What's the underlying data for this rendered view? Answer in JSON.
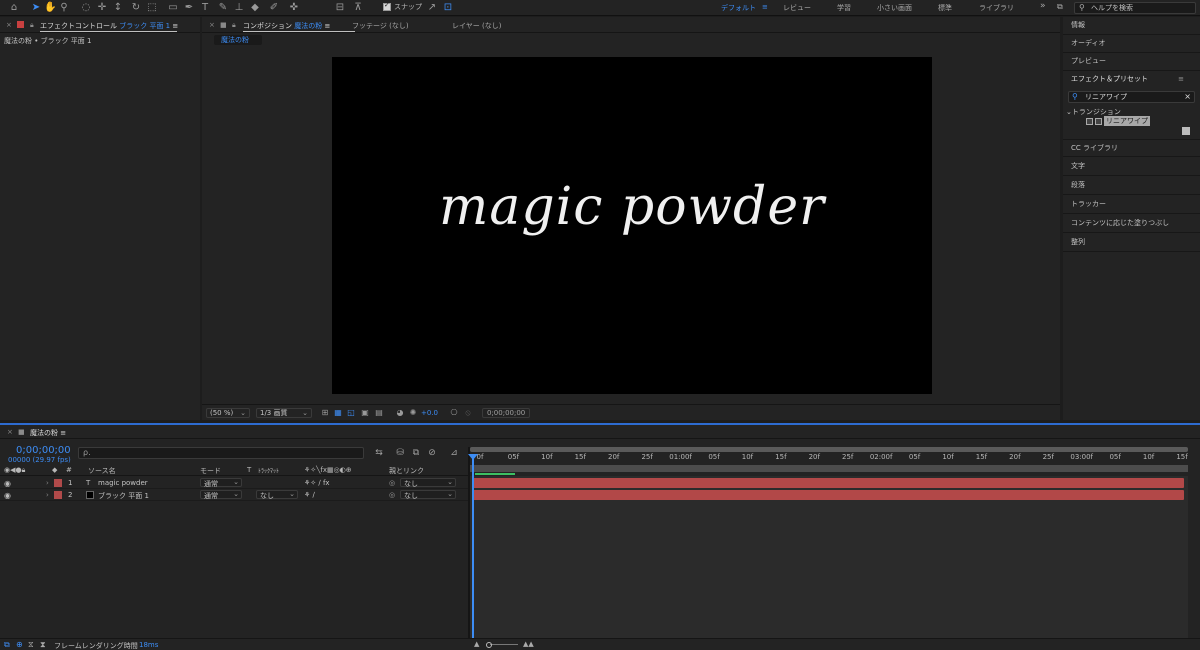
{
  "workspaces": [
    {
      "label": "デフォルト",
      "active": true
    },
    {
      "label": "レビュー"
    },
    {
      "label": "学習"
    },
    {
      "label": "小さい画面"
    },
    {
      "label": "標準"
    },
    {
      "label": "ライブラリ"
    }
  ],
  "toolbar": {
    "snap_label": "スナップ",
    "help_placeholder": "ヘルプを検索"
  },
  "effect_controls": {
    "title": "エフェクトコントロール",
    "title_layer": "ブラック 平面 1",
    "subtitle": "魔法の粉 • ブラック 平面 1"
  },
  "composition": {
    "title": "コンポジション",
    "title_name": "魔法の粉",
    "tab_footage": "フッテージ (なし)",
    "tab_layer": "レイヤー (なし)",
    "comp_tab": "魔法の粉",
    "canvas_text": "magic powder",
    "zoom": "(50 %)",
    "resolution": "1/3 画質",
    "exposure": "+0.0",
    "timecode": "0;00;00;00"
  },
  "right_panel": {
    "items": [
      "情報",
      "オーディオ",
      "プレビュー"
    ],
    "effects_presets_title": "エフェクト＆プリセット",
    "search_value": "リニアワイプ",
    "tree_folder": "トランジション",
    "tree_leaf": "リニアワイプ",
    "items_below": [
      "CC ライブラリ",
      "文字",
      "段落",
      "トラッカー",
      "コンテンツに応じた塗りつぶし",
      "整列"
    ]
  },
  "timeline": {
    "tab_title": "魔法の粉",
    "current_time": "0;00;00;00",
    "fps": "00000 (29.97 fps)",
    "search_placeholder": "ρ.",
    "columns": {
      "source_name": "ソース名",
      "mode": "モード",
      "t": "T",
      "trkmat": "ﾄﾗｯｸﾏｯﾄ",
      "parent_link": "親とリンク"
    },
    "layers": [
      {
        "index": "1",
        "type": "T",
        "name": "magic powder",
        "mode": "通常",
        "trkmat": "",
        "parent": "なし"
      },
      {
        "index": "2",
        "type": "",
        "name": "ブラック 平面 1",
        "mode": "通常",
        "trkmat": "なし",
        "parent": "なし"
      }
    ],
    "ruler_ticks": [
      "0f",
      "05f",
      "10f",
      "15f",
      "20f",
      "25f",
      "01:00f",
      "05f",
      "10f",
      "15f",
      "20f",
      "25f",
      "02:00f",
      "05f",
      "10f",
      "15f",
      "20f",
      "25f",
      "03:00f",
      "05f",
      "10f",
      "15f"
    ],
    "status_label": "フレームレンダリング時間",
    "status_value": "18ms"
  },
  "colors": {
    "accent": "#3d8df5",
    "label_red": "#b24848"
  }
}
